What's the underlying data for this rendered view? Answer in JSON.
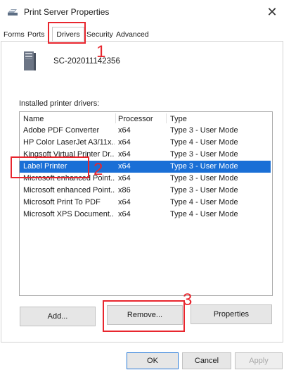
{
  "window": {
    "title": "Print Server Properties",
    "close_glyph": "✕"
  },
  "tabs": [
    {
      "label": "Forms"
    },
    {
      "label": "Ports"
    },
    {
      "label": "Drivers"
    },
    {
      "label": "Security"
    },
    {
      "label": "Advanced"
    }
  ],
  "server": {
    "name": "SC-202011142356"
  },
  "drivers_section": {
    "label": "Installed printer drivers:",
    "columns": {
      "name": "Name",
      "processor": "Processor",
      "type": "Type"
    },
    "rows": [
      {
        "name": "Adobe PDF Converter",
        "processor": "x64",
        "type": "Type 3 - User Mode"
      },
      {
        "name": "HP Color LaserJet A3/11x...",
        "processor": "x64",
        "type": "Type 4 - User Mode"
      },
      {
        "name": "Kingsoft Virtual Printer Dr...",
        "processor": "x64",
        "type": "Type 3 - User Mode"
      },
      {
        "name": "Label Printer",
        "processor": "x64",
        "type": "Type 3 - User Mode"
      },
      {
        "name": "Microsoft enhanced Point...",
        "processor": "x64",
        "type": "Type 3 - User Mode"
      },
      {
        "name": "Microsoft enhanced Point...",
        "processor": "x86",
        "type": "Type 3 - User Mode"
      },
      {
        "name": "Microsoft Print To PDF",
        "processor": "x64",
        "type": "Type 4 - User Mode"
      },
      {
        "name": "Microsoft XPS Document...",
        "processor": "x64",
        "type": "Type 4 - User Mode"
      }
    ],
    "selected_row": 3
  },
  "buttons": {
    "add": "Add...",
    "remove": "Remove...",
    "properties": "Properties",
    "ok": "OK",
    "cancel": "Cancel",
    "apply": "Apply"
  },
  "annotations": {
    "step1": "1",
    "step2": "2",
    "step3": "3"
  },
  "colors": {
    "selection": "#1a6fd6",
    "annotation": "#e8262e"
  },
  "icons": {
    "printer": "printer-icon",
    "server": "server-tower-icon",
    "close": "close-icon"
  }
}
